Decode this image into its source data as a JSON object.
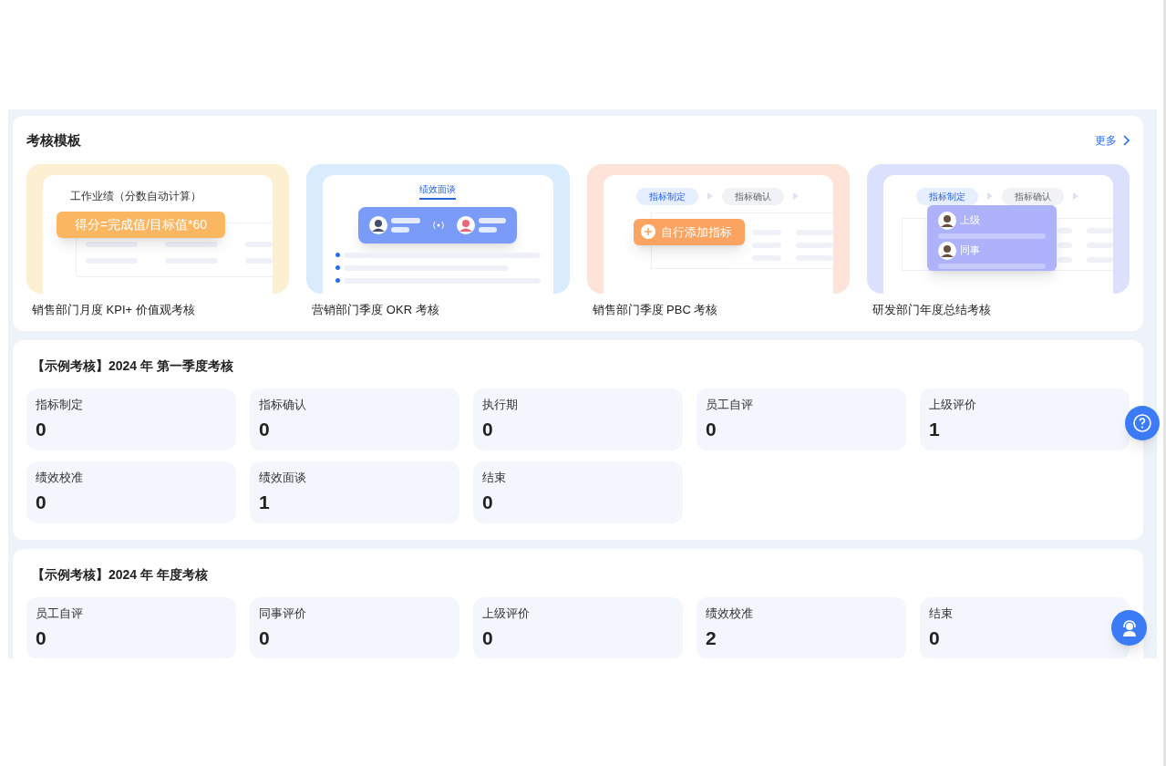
{
  "templates_section": {
    "title": "考核模板",
    "more_link": "更多"
  },
  "templates": [
    {
      "kind": "formula",
      "color": "#fdf0d2",
      "name": "销售部门月度 KPI+ 价值观考核",
      "preview": {
        "heading": "工作业绩（分数自动计算）",
        "highlight": "得分=完成值/目标值*60"
      }
    },
    {
      "kind": "interview",
      "color": "#d9ecfd",
      "name": "营销部门季度 OKR 考核",
      "preview": {
        "heading": "绩效面谈"
      }
    },
    {
      "kind": "add_metric",
      "color": "#fde3d8",
      "name": "销售部门季度 PBC 考核",
      "preview": {
        "steps": [
          "指标制定",
          "指标确认"
        ],
        "highlight": "自行添加指标"
      }
    },
    {
      "kind": "reviewers",
      "color": "#dbe1fd",
      "name": "研发部门年度总结考核",
      "preview": {
        "steps": [
          "指标制定",
          "指标确认"
        ],
        "reviewers": [
          "上级",
          "同事"
        ]
      }
    }
  ],
  "reviews": [
    {
      "title": "【示例考核】2024 年 第一季度考核",
      "stages": [
        {
          "label": "指标制定",
          "count": "0"
        },
        {
          "label": "指标确认",
          "count": "0"
        },
        {
          "label": "执行期",
          "count": "0"
        },
        {
          "label": "员工自评",
          "count": "0"
        },
        {
          "label": "上级评价",
          "count": "1"
        },
        {
          "label": "绩效校准",
          "count": "0"
        },
        {
          "label": "绩效面谈",
          "count": "1"
        },
        {
          "label": "结束",
          "count": "0"
        }
      ]
    },
    {
      "title": "【示例考核】2024 年 年度考核",
      "stages": [
        {
          "label": "员工自评",
          "count": "0"
        },
        {
          "label": "同事评价",
          "count": "0"
        },
        {
          "label": "上级评价",
          "count": "0"
        },
        {
          "label": "绩效校准",
          "count": "2"
        },
        {
          "label": "结束",
          "count": "0"
        }
      ]
    }
  ]
}
